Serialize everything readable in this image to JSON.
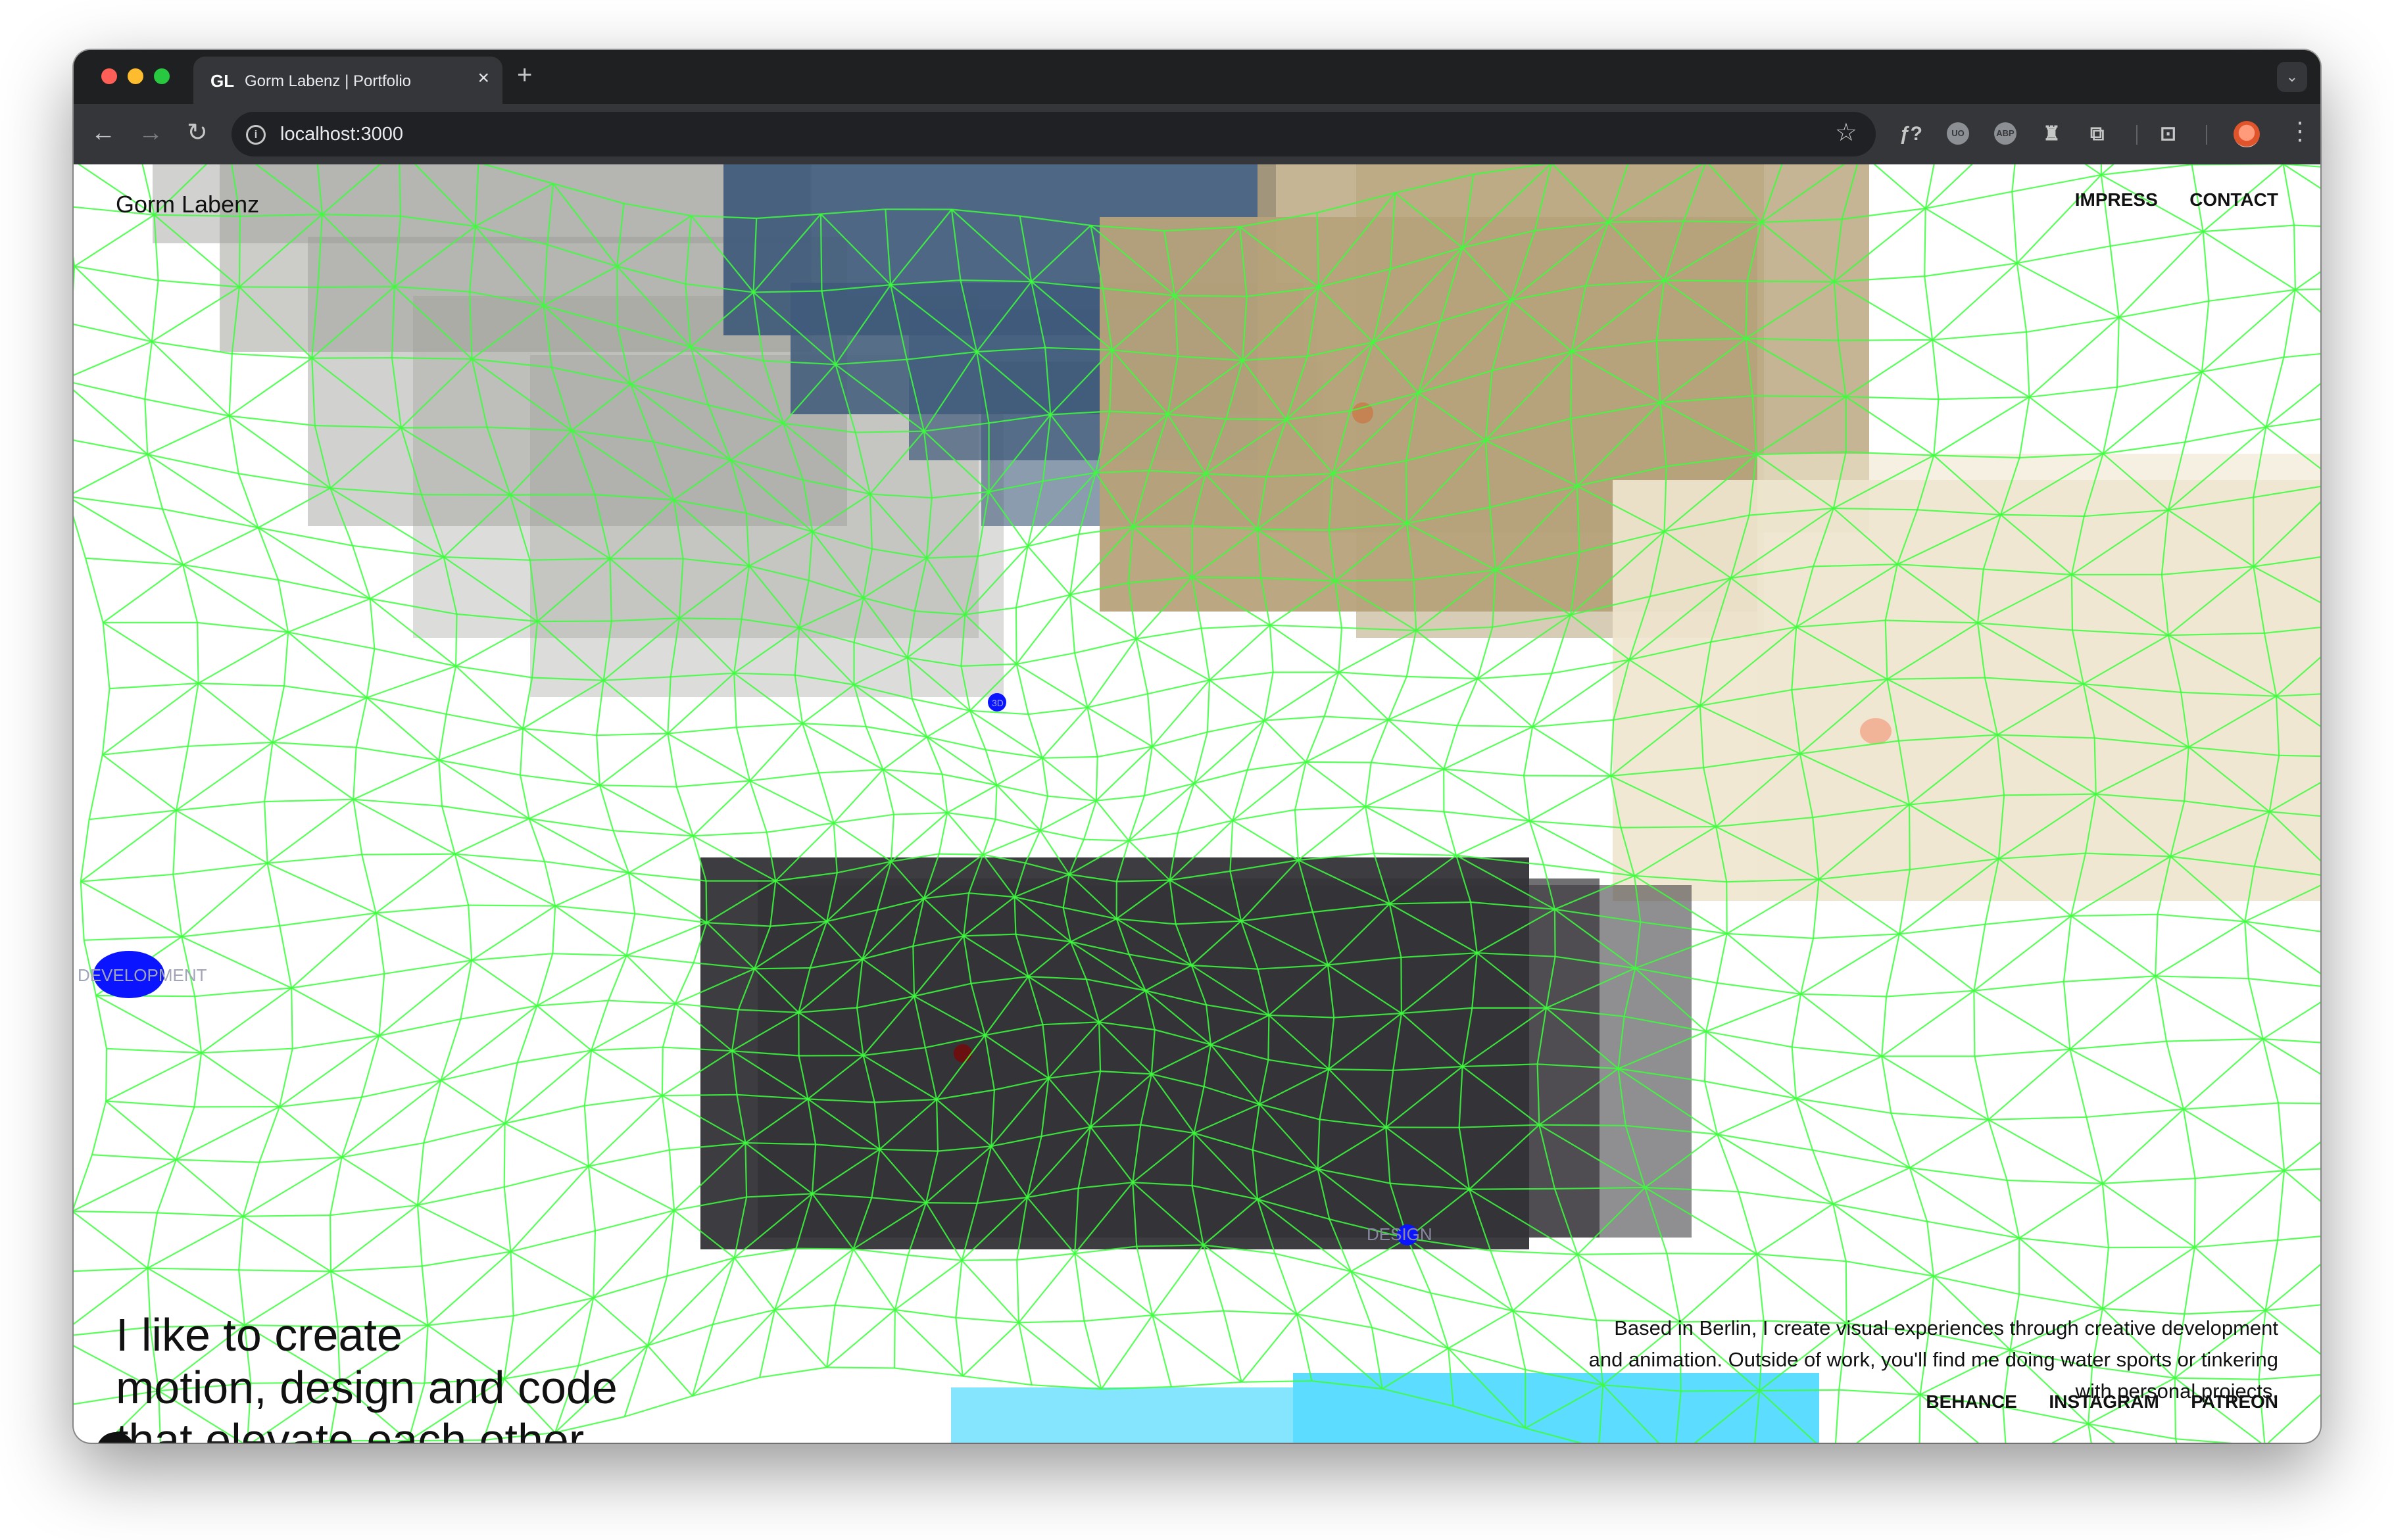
{
  "browser": {
    "tab": {
      "favicon_text": "GL",
      "title": "Gorm Labenz | Portfolio",
      "close": "×"
    },
    "new_tab": "+",
    "tab_search": "⌄",
    "nav": {
      "back": "←",
      "forward": "→",
      "reload": "↻"
    },
    "address": {
      "info": "i",
      "url": "localhost:3000",
      "star": "☆"
    },
    "extensions": [
      {
        "name": "ff-script-icon",
        "label": "ƒ?"
      },
      {
        "name": "ublock-icon",
        "label": "UO"
      },
      {
        "name": "adblock-plus-icon",
        "label": "ABP"
      },
      {
        "name": "relay-icon",
        "label": "♜"
      },
      {
        "name": "extensions-puzzle-icon",
        "label": "⧉"
      },
      {
        "name": "screenshot-icon",
        "label": "⊡"
      }
    ],
    "menu": "⋮"
  },
  "page": {
    "brand": "Gorm Labenz",
    "nav": [
      "IMPRESS",
      "CONTACT"
    ],
    "hero": [
      "I like to create",
      "motion, design and code",
      "that elevate each other"
    ],
    "bio": "Based in Berlin, I create visual experiences through creative development and animation. Outside of work, you'll find me doing water sports or tinkering with personal projects.",
    "social": [
      "BEHANCE",
      "INSTAGRAM",
      "PATREON"
    ],
    "canvas_labels": {
      "development": "DEVELOPMENT",
      "design": "DESIGN",
      "small_node": "3D"
    },
    "dev_badge": "ϟ",
    "colors": {
      "mesh": "#3cff3c",
      "node": "#0a14ff",
      "panel_gray": "#9a9a94",
      "panel_blue": "#3f5a7a",
      "panel_gold": "#b7a27a",
      "panel_cream": "#efe6cf",
      "panel_dark": "#333236",
      "panel_cyan": "#5cdcff"
    }
  }
}
